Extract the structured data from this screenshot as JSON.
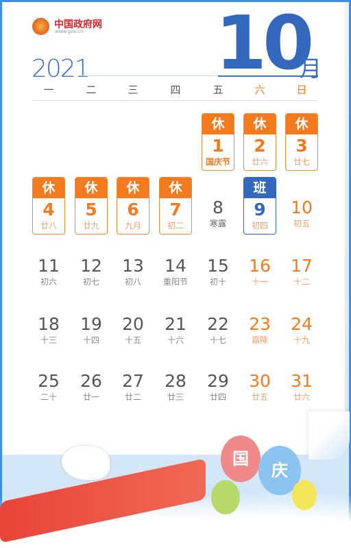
{
  "header": {
    "site_name": "中国政府网",
    "site_url": "www.gov.cn",
    "year": "2021",
    "month": "10",
    "month_suffix": "月"
  },
  "weekdays": [
    "一",
    "二",
    "三",
    "四",
    "五",
    "六",
    "日"
  ],
  "colors": {
    "holiday": "#f47a1f",
    "workday": "#3468bd",
    "weekend": "#f47a1f",
    "text": "#555555"
  },
  "weeks": [
    [
      null,
      null,
      null,
      null,
      {
        "day": "1",
        "lunar": "国庆节",
        "badge": "休",
        "type": "holiday",
        "festival": true
      },
      {
        "day": "2",
        "lunar": "廿六",
        "badge": "休",
        "type": "holiday"
      },
      {
        "day": "3",
        "lunar": "廿七",
        "badge": "休",
        "type": "holiday"
      }
    ],
    [
      {
        "day": "4",
        "lunar": "廿八",
        "badge": "休",
        "type": "holiday"
      },
      {
        "day": "5",
        "lunar": "廿九",
        "badge": "休",
        "type": "holiday"
      },
      {
        "day": "6",
        "lunar": "九月",
        "badge": "休",
        "type": "holiday"
      },
      {
        "day": "7",
        "lunar": "初二",
        "badge": "休",
        "type": "holiday"
      },
      {
        "day": "8",
        "lunar": "寒露",
        "type": "normal",
        "solar_term": true
      },
      {
        "day": "9",
        "lunar": "初四",
        "badge": "班",
        "type": "workday"
      },
      {
        "day": "10",
        "lunar": "初五",
        "type": "weekend"
      }
    ],
    [
      {
        "day": "11",
        "lunar": "初六",
        "type": "normal"
      },
      {
        "day": "12",
        "lunar": "初七",
        "type": "normal"
      },
      {
        "day": "13",
        "lunar": "初八",
        "type": "normal"
      },
      {
        "day": "14",
        "lunar": "重阳节",
        "type": "normal"
      },
      {
        "day": "15",
        "lunar": "初十",
        "type": "normal"
      },
      {
        "day": "16",
        "lunar": "十一",
        "type": "weekend"
      },
      {
        "day": "17",
        "lunar": "十二",
        "type": "weekend"
      }
    ],
    [
      {
        "day": "18",
        "lunar": "十三",
        "type": "normal"
      },
      {
        "day": "19",
        "lunar": "十四",
        "type": "normal"
      },
      {
        "day": "20",
        "lunar": "十五",
        "type": "normal"
      },
      {
        "day": "21",
        "lunar": "十六",
        "type": "normal"
      },
      {
        "day": "22",
        "lunar": "十七",
        "type": "normal"
      },
      {
        "day": "23",
        "lunar": "霜降",
        "type": "weekend"
      },
      {
        "day": "24",
        "lunar": "十九",
        "type": "weekend"
      }
    ],
    [
      {
        "day": "25",
        "lunar": "二十",
        "type": "normal"
      },
      {
        "day": "26",
        "lunar": "廿一",
        "type": "normal"
      },
      {
        "day": "27",
        "lunar": "廿二",
        "type": "normal"
      },
      {
        "day": "28",
        "lunar": "廿三",
        "type": "normal"
      },
      {
        "day": "29",
        "lunar": "廿四",
        "type": "normal"
      },
      {
        "day": "30",
        "lunar": "廿五",
        "type": "weekend"
      },
      {
        "day": "31",
        "lunar": "廿六",
        "type": "weekend"
      }
    ]
  ],
  "illustration": {
    "balloon_text_1": "国",
    "balloon_text_2": "庆"
  }
}
